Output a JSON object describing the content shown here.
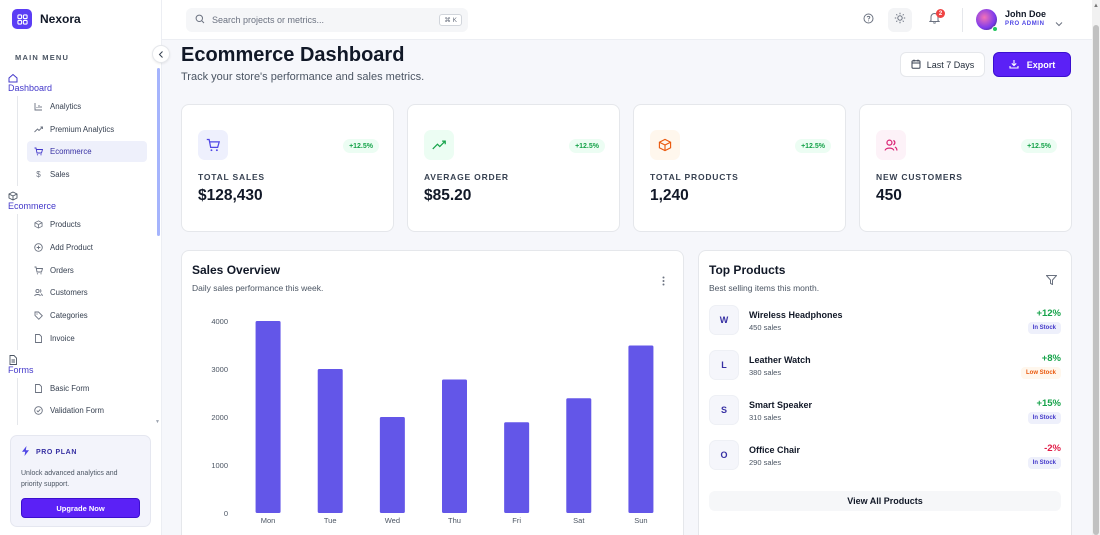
{
  "brand": {
    "name": "Nexora"
  },
  "sidebar": {
    "heading": "MAIN MENU",
    "groups": [
      {
        "label": "Dashboard",
        "icon": "home-icon",
        "items": [
          {
            "label": "Analytics",
            "icon": "bar-chart-icon"
          },
          {
            "label": "Premium Analytics",
            "icon": "trending-up-icon"
          },
          {
            "label": "Ecommerce",
            "icon": "cart-icon",
            "active": true
          },
          {
            "label": "Sales",
            "icon": "dollar-icon"
          }
        ]
      },
      {
        "label": "Ecommerce",
        "icon": "box-icon",
        "items": [
          {
            "label": "Products",
            "icon": "box-icon"
          },
          {
            "label": "Add Product",
            "icon": "plus-circle-icon"
          },
          {
            "label": "Orders",
            "icon": "cart-icon"
          },
          {
            "label": "Customers",
            "icon": "users-icon"
          },
          {
            "label": "Categories",
            "icon": "tag-icon"
          },
          {
            "label": "Invoice",
            "icon": "file-icon"
          }
        ]
      },
      {
        "label": "Forms",
        "icon": "document-icon",
        "items": [
          {
            "label": "Basic Form",
            "icon": "file-icon"
          },
          {
            "label": "Validation Form",
            "icon": "check-circle-icon"
          }
        ]
      }
    ],
    "pro_card": {
      "title": "PRO PLAN",
      "description": "Unlock advanced analytics and priority support.",
      "button": "Upgrade Now"
    }
  },
  "header": {
    "search_placeholder": "Search projects or metrics...",
    "shortcut": "⌘ K",
    "notification_count": "2",
    "user": {
      "name": "John Doe",
      "role": "PRO ADMIN"
    }
  },
  "page": {
    "title": "Ecommerce Dashboard",
    "subtitle": "Track your store's performance and sales metrics.",
    "date_range": "Last 7 Days",
    "export_label": "Export"
  },
  "stats": [
    {
      "label": "TOTAL SALES",
      "value": "$128,430",
      "change": "+12.5%",
      "icon": "cart-icon",
      "icon_bg": "#eef0fd",
      "icon_color": "#4f46e5"
    },
    {
      "label": "AVERAGE ORDER",
      "value": "$85.20",
      "change": "+12.5%",
      "icon": "trending-up-icon",
      "icon_bg": "#ecfdf3",
      "icon_color": "#16a34a"
    },
    {
      "label": "TOTAL PRODUCTS",
      "value": "1,240",
      "change": "+12.5%",
      "icon": "box-icon",
      "icon_bg": "#fff7ed",
      "icon_color": "#ea580c"
    },
    {
      "label": "NEW CUSTOMERS",
      "value": "450",
      "change": "+12.5%",
      "icon": "users-icon",
      "icon_bg": "#fdf2f8",
      "icon_color": "#db2777"
    }
  ],
  "sales_overview": {
    "title": "Sales Overview",
    "subtitle": "Daily sales performance this week."
  },
  "chart_data": {
    "type": "bar",
    "categories": [
      "Mon",
      "Tue",
      "Wed",
      "Thu",
      "Fri",
      "Sat",
      "Sun"
    ],
    "values": [
      4000,
      3000,
      2000,
      2780,
      1890,
      2390,
      3490
    ],
    "yticks": [
      0,
      1000,
      2000,
      3000,
      4000
    ],
    "ylim": [
      0,
      4000
    ],
    "grid": false,
    "color": "#6356e8"
  },
  "top_products": {
    "title": "Top Products",
    "subtitle": "Best selling items this month.",
    "items": [
      {
        "initial": "W",
        "name": "Wireless Headphones",
        "sales": "450 sales",
        "change": "+12%",
        "status": "In Stock",
        "change_color": "#16a34a",
        "status_bg": "#eef0fb",
        "status_color": "#4338ca"
      },
      {
        "initial": "L",
        "name": "Leather Watch",
        "sales": "380 sales",
        "change": "+8%",
        "status": "Low Stock",
        "change_color": "#16a34a",
        "status_bg": "#fff7ed",
        "status_color": "#ea580c"
      },
      {
        "initial": "S",
        "name": "Smart Speaker",
        "sales": "310 sales",
        "change": "+15%",
        "status": "In Stock",
        "change_color": "#16a34a",
        "status_bg": "#eef0fb",
        "status_color": "#4338ca"
      },
      {
        "initial": "O",
        "name": "Office Chair",
        "sales": "290 sales",
        "change": "-2%",
        "status": "In Stock",
        "change_color": "#e11d48",
        "status_bg": "#eef0fb",
        "status_color": "#4338ca"
      }
    ],
    "view_all": "View All Products"
  }
}
